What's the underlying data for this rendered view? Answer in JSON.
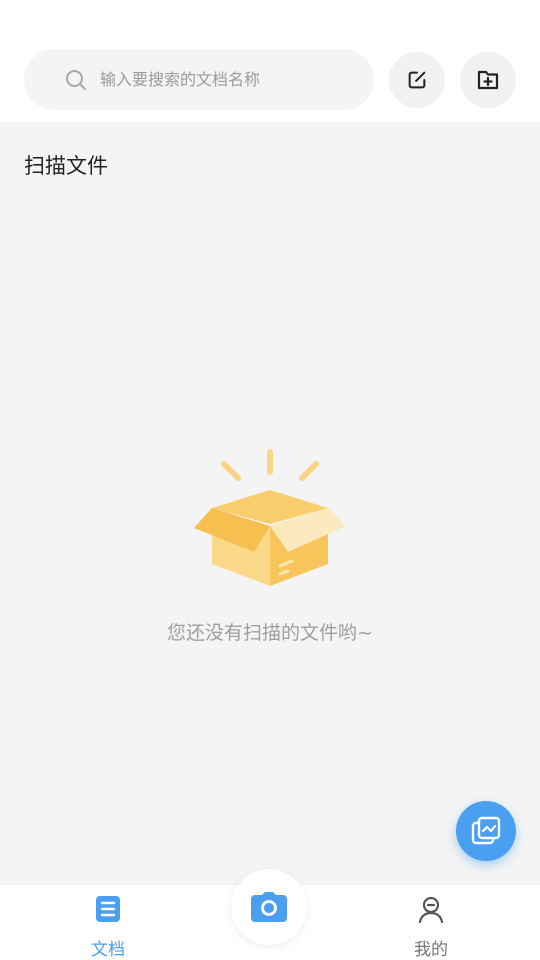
{
  "search": {
    "placeholder": "输入要搜索的文档名称",
    "value": ""
  },
  "section": {
    "title": "扫描文件"
  },
  "empty": {
    "message": "您还没有扫描的文件哟~"
  },
  "tabs": [
    {
      "label": "文档",
      "icon": "document-icon",
      "active": true
    },
    {
      "label": "我的",
      "icon": "user-icon",
      "active": false
    }
  ],
  "colors": {
    "accent": "#4a9ff0",
    "box": "#f7c55a",
    "background": "#f4f4f4"
  }
}
